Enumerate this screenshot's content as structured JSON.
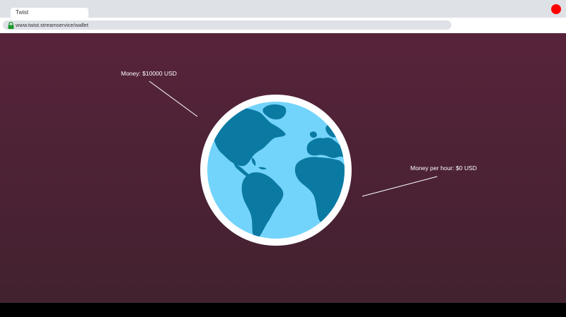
{
  "browser": {
    "tab_title": "Twist",
    "url": "www.twist.streamservice/wallet",
    "close_color": "#ff0000"
  },
  "wallet": {
    "money_label": "Money: $10000 USD",
    "money_per_hour_label": "Money per hour: $0 USD"
  },
  "icons": {
    "lock": "lock-icon",
    "globe": "globe-icon"
  },
  "colors": {
    "background_top": "#57233b",
    "background_bottom": "#42222f",
    "ocean": "#73d4fb",
    "land": "#0b7aa3",
    "globe_border": "#ffffff"
  }
}
